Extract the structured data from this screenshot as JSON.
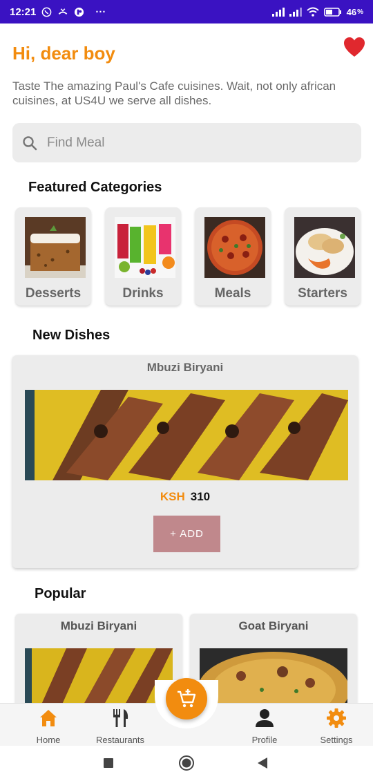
{
  "status_bar": {
    "time": "12:21",
    "menu_dots": "···",
    "battery_percent": "46"
  },
  "header": {
    "greeting": "Hi, dear boy",
    "subtitle": "Taste The amazing Paul's Cafe cuisines. Wait, not only african cuisines, at US4U we serve all dishes."
  },
  "search": {
    "placeholder": "Find Meal"
  },
  "featured": {
    "title": "Featured Categories",
    "categories": [
      {
        "label": "Desserts"
      },
      {
        "label": "Drinks"
      },
      {
        "label": "Meals"
      },
      {
        "label": "Starters"
      }
    ]
  },
  "new_dishes": {
    "title": "New Dishes",
    "item": {
      "name": "Mbuzi Biryani",
      "currency": "KSH",
      "price": "310",
      "add_label": "+ ADD"
    }
  },
  "popular": {
    "title": "Popular",
    "items": [
      {
        "name": "Mbuzi Biryani"
      },
      {
        "name": "Goat Biryani"
      }
    ]
  },
  "bottom_nav": {
    "items": [
      {
        "label": "Home",
        "icon": "home-icon",
        "active": true
      },
      {
        "label": "Restaurants",
        "icon": "fork-knife-icon",
        "active": false
      },
      {
        "label": "Profile",
        "icon": "person-icon",
        "active": false
      },
      {
        "label": "Settings",
        "icon": "gear-icon",
        "active": false
      }
    ],
    "fab_icon": "add-to-cart-icon"
  },
  "colors": {
    "accent": "#f28c0f",
    "status_bar": "#3a12c2",
    "add_button": "#c0888c",
    "heart": "#e0282e"
  }
}
